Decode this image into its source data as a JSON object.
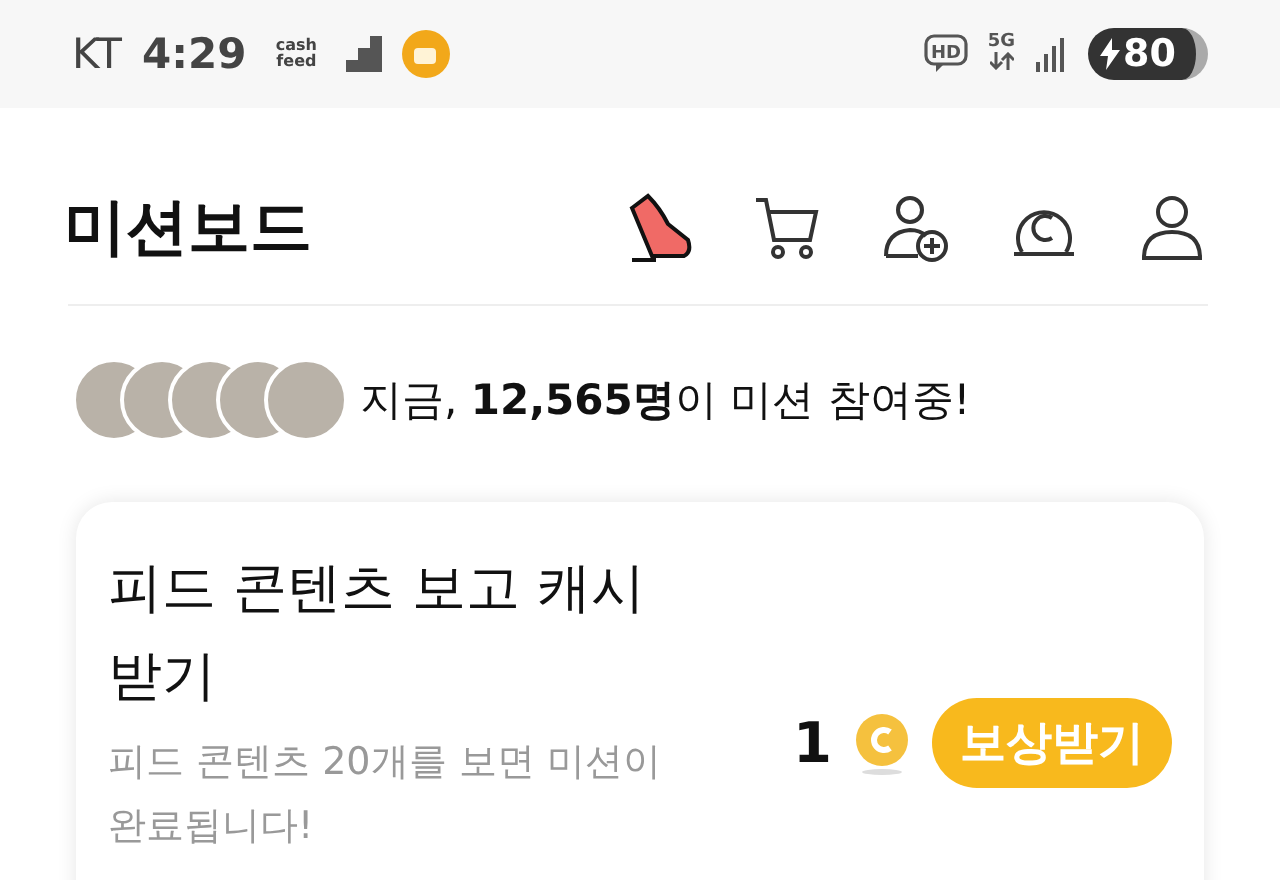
{
  "status_bar": {
    "carrier": "KT",
    "time": "4:29",
    "app_logo": "cash feed",
    "hd": "HD",
    "network": "5G",
    "battery": "80"
  },
  "header": {
    "title": "미션보드"
  },
  "participants": {
    "text": "지금, **12,565명**이 미션 참여중!"
  },
  "mission": {
    "title": "피드 콘텐츠 보고 캐시 받기",
    "description": "피드 콘텐츠 20개를 보면 미션이 완료됩니다!",
    "reward": "1",
    "button": "보상받기"
  }
}
